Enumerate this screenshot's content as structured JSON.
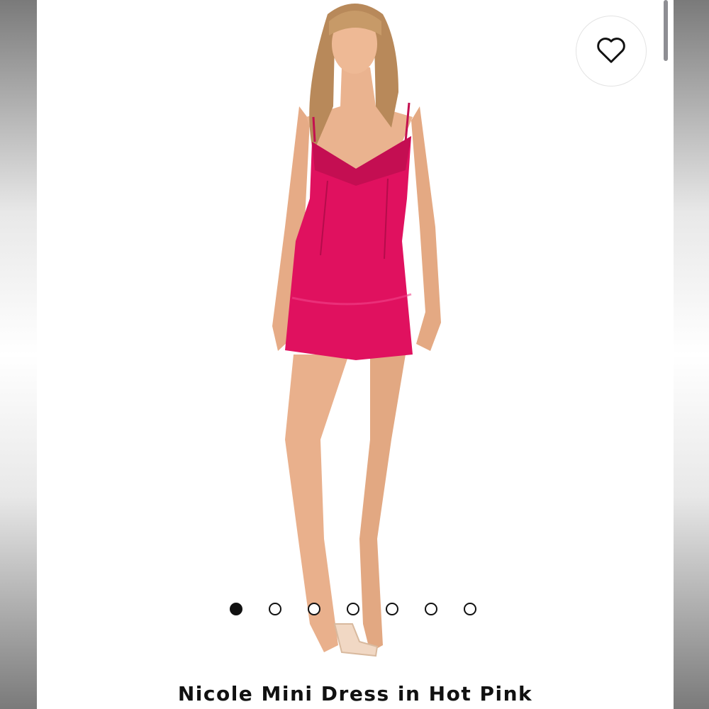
{
  "product": {
    "title": "Nicole Mini Dress in Hot Pink",
    "dress_color": "#E0115F",
    "image_alt": "Model wearing Nicole Mini Dress in Hot Pink"
  },
  "wishlist": {
    "icon": "heart-outline-icon"
  },
  "carousel": {
    "total_slides": 7,
    "active_index": 0
  }
}
